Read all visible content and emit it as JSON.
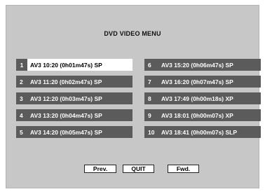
{
  "menu": {
    "title": "DVD VIDEO MENU"
  },
  "left_items": [
    {
      "num": "1",
      "entry": "AV3 10:20  (0h01m47s)  SP",
      "selected": true
    },
    {
      "num": "2",
      "entry": "AV3 11:20  (0h02m47s)  SP",
      "selected": false
    },
    {
      "num": "3",
      "entry": "AV3 12:20  (0h03m47s)  SP",
      "selected": false
    },
    {
      "num": "4",
      "entry": "AV3 13:20  (0h04m47s)  SP",
      "selected": false
    },
    {
      "num": "5",
      "entry": "AV3 14:20  (0h05m47s)  SP",
      "selected": false
    }
  ],
  "right_items": [
    {
      "num": "6",
      "entry": "AV3 15:20  (0h06m47s)  SP",
      "selected": false
    },
    {
      "num": "7",
      "entry": "AV3 16:20  (0h07m47s)  SP",
      "selected": false
    },
    {
      "num": "8",
      "entry": "AV3 17:49  (0h00m18s)  XP",
      "selected": false
    },
    {
      "num": "9",
      "entry": "AV3 18:01  (0h00m07s)  XP",
      "selected": false
    },
    {
      "num": "10",
      "entry": "AV3 18:41  (0h00m07s) SLP",
      "selected": false
    }
  ],
  "buttons": {
    "prev_label": "Prev.",
    "quit_label": "QUIT",
    "fwd_label": "Fwd."
  },
  "colors": {
    "background": "#c7c7c7",
    "item_bg": "#5b5b5b",
    "selected_bg": "#ffffff"
  }
}
